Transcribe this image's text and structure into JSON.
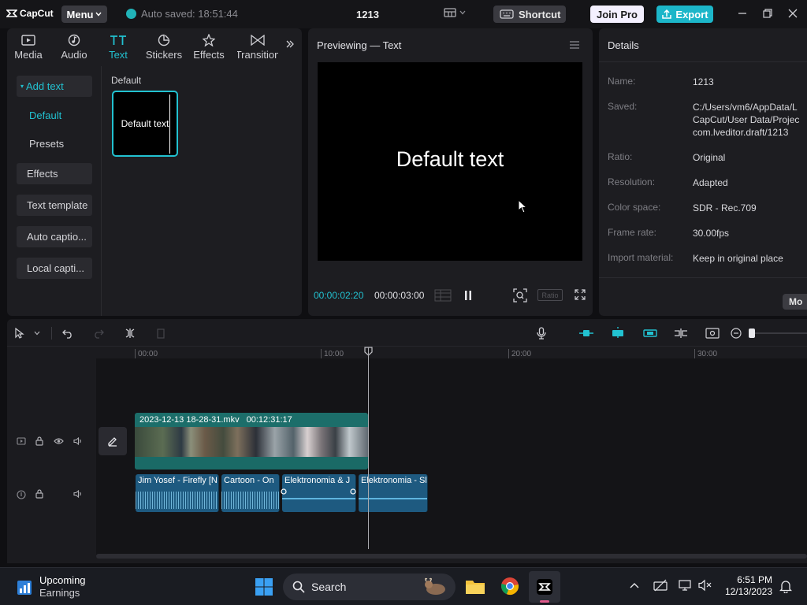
{
  "titlebar": {
    "app_name": "CapCut",
    "menu_label": "Menu",
    "autosave_text": "Auto saved: 18:51:44",
    "project_title": "1213",
    "shortcut_label": "Shortcut",
    "joinpro_label": "Join Pro",
    "export_label": "Export"
  },
  "left_panel": {
    "tabs": [
      {
        "label": "Media",
        "icon": "media-icon"
      },
      {
        "label": "Audio",
        "icon": "audio-icon"
      },
      {
        "label": "Text",
        "icon": "text-icon",
        "active": true
      },
      {
        "label": "Stickers",
        "icon": "stickers-icon"
      },
      {
        "label": "Effects",
        "icon": "effects-icon"
      },
      {
        "label": "Transition",
        "icon": "transition-icon"
      }
    ],
    "sidebar": [
      {
        "label": "Add text",
        "state": "expanded"
      },
      {
        "label": "Default",
        "state": "selected"
      },
      {
        "label": "Presets"
      },
      {
        "label": "Effects"
      },
      {
        "label": "Text template"
      },
      {
        "label": "Auto captio..."
      },
      {
        "label": "Local capti..."
      }
    ],
    "content_heading": "Default",
    "card_text": "Default text"
  },
  "preview": {
    "title": "Previewing — Text",
    "canvas_text": "Default text",
    "current_time": "00:00:02:20",
    "total_time": "00:00:03:00",
    "ratio_label": "Ratio"
  },
  "details": {
    "title": "Details",
    "rows": [
      {
        "key": "Name:",
        "value": "1213"
      },
      {
        "key": "Saved:",
        "value": "C:/Users/vm6/AppData/L\nCapCut/User Data/Projec\ncom.lveditor.draft/1213"
      },
      {
        "key": "Ratio:",
        "value": "Original"
      },
      {
        "key": "Resolution:",
        "value": "Adapted"
      },
      {
        "key": "Color space:",
        "value": "SDR - Rec.709"
      },
      {
        "key": "Frame rate:",
        "value": "30.00fps"
      },
      {
        "key": "Import material:",
        "value": "Keep in original place"
      }
    ],
    "modify_label": "Mo"
  },
  "timeline": {
    "ruler": [
      "00:00",
      "10:00",
      "20:00",
      "30:00"
    ],
    "video_clip": {
      "name": "2023-12-13 18-28-31.mkv",
      "duration": "00:12:31:17"
    },
    "audio_clips": [
      "Jim Yosef - Firefly [N",
      "Cartoon - On",
      "Elektronomia & J",
      "Elektronomia - Sl"
    ]
  },
  "taskbar": {
    "weather_title": "Upcoming",
    "weather_sub": "Earnings",
    "search_placeholder": "Search",
    "time": "6:51 PM",
    "date": "12/13/2023"
  },
  "colors": {
    "accent": "#22c2d1",
    "export": "#1cb6c9",
    "video_clip": "#1c6e6a",
    "audio_clip": "#1e5a80"
  }
}
